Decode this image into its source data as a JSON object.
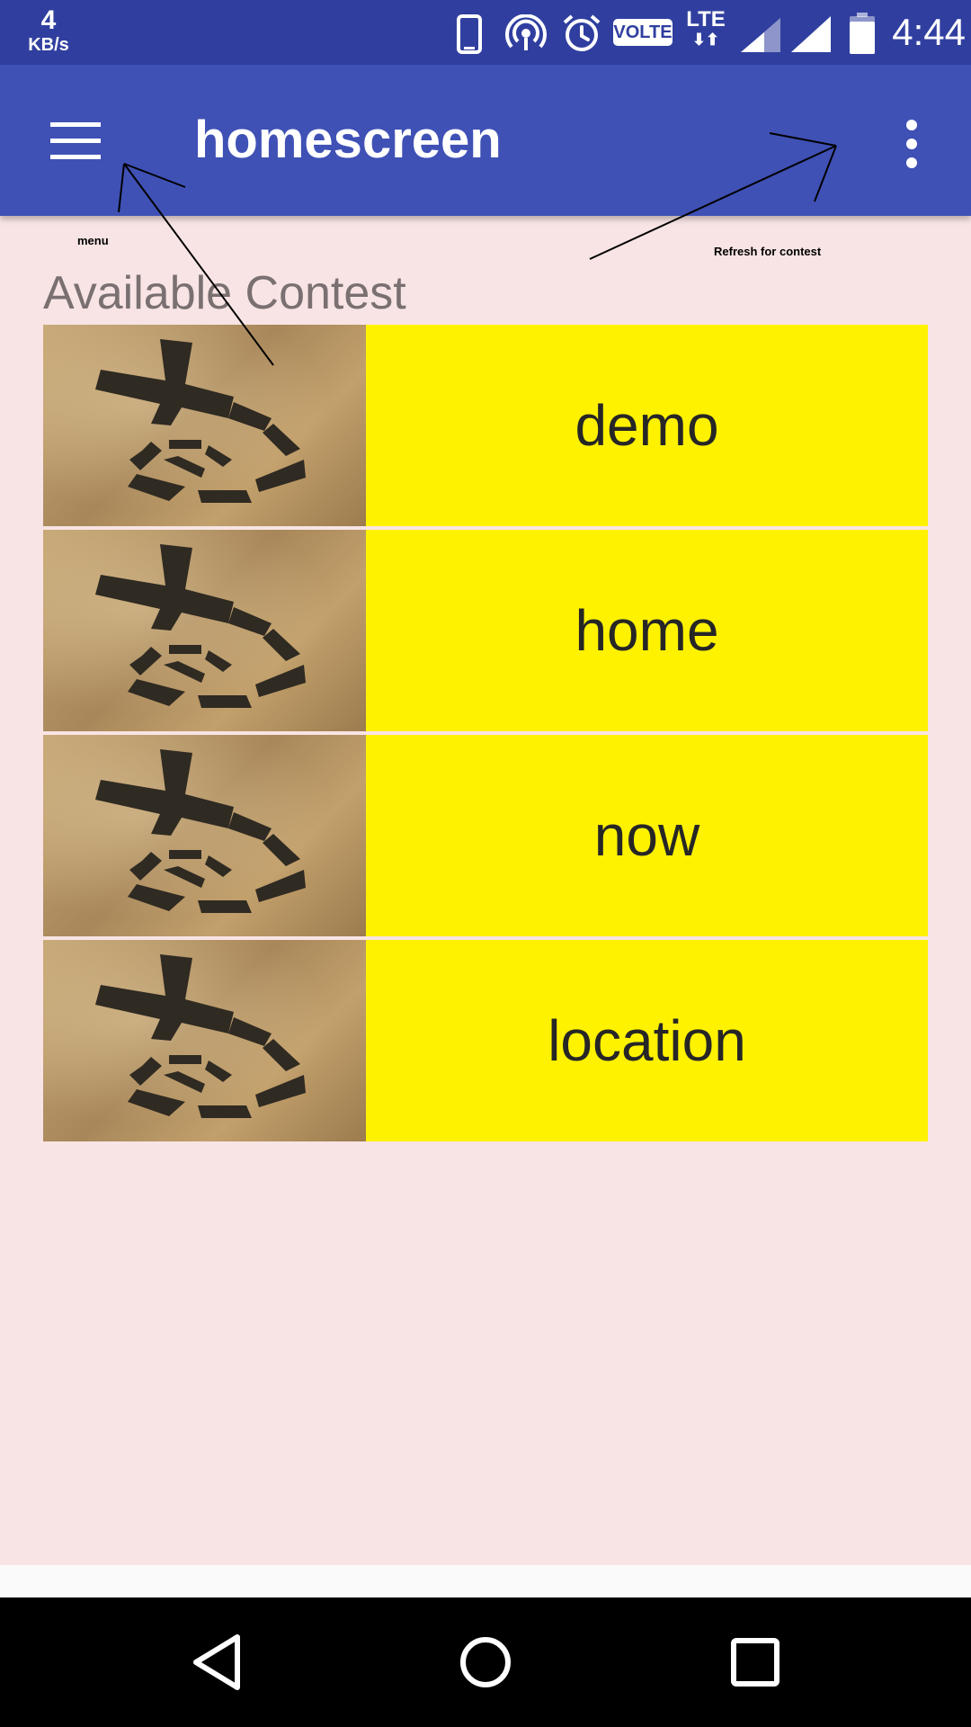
{
  "status_bar": {
    "net_speed_value": "4",
    "net_speed_unit": "KB/s",
    "volte_label": "VOLTE",
    "lte_label": "LTE",
    "lte_arrows": "⬇⬆",
    "time": "4:44",
    "icons": [
      "phone-icon",
      "hotspot-icon",
      "alarm-icon",
      "volte-icon",
      "lte-icon",
      "signal-icon",
      "signal-icon",
      "battery-icon"
    ],
    "background_color": "#303f9f"
  },
  "app_bar": {
    "title": "homescreen",
    "menu_icon": "hamburger-menu-icon",
    "overflow_icon": "more-vertical-icon",
    "background_color": "#3f51b5"
  },
  "annotations": {
    "menu_note": "menu",
    "refresh_note": "Refresh for contest"
  },
  "content": {
    "section_title": "Available Contest",
    "contests": [
      {
        "label": "demo",
        "thumbnail": "contest-logo-image"
      },
      {
        "label": "home",
        "thumbnail": "contest-logo-image"
      },
      {
        "label": "now",
        "thumbnail": "contest-logo-image"
      },
      {
        "label": "location",
        "thumbnail": "contest-logo-image"
      }
    ],
    "label_background_color": "#fff200",
    "page_background_color": "#f8e4e4"
  },
  "nav_bar": {
    "buttons": [
      "back-icon",
      "home-icon",
      "recents-icon"
    ]
  }
}
